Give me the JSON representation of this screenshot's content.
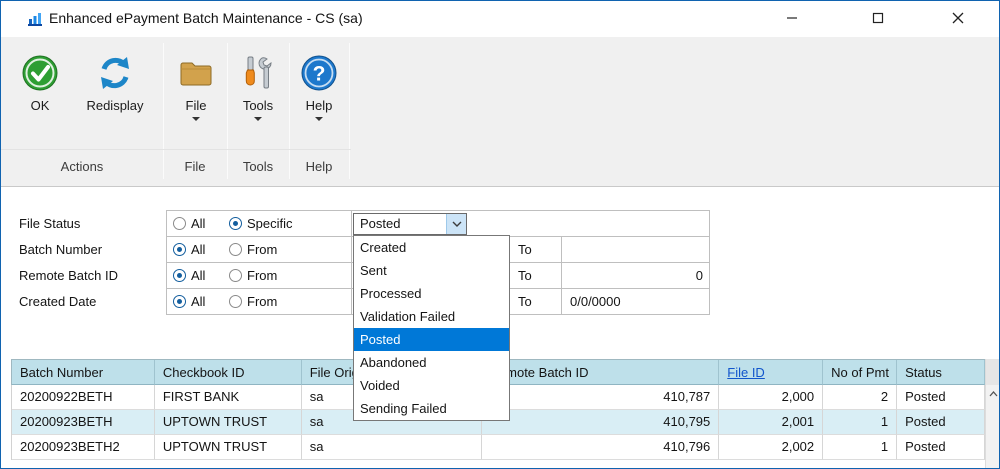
{
  "titlebar": {
    "title": "Enhanced ePayment Batch Maintenance - CS (sa)"
  },
  "ribbon": {
    "buttons": [
      {
        "label": "OK"
      },
      {
        "label": "Redisplay"
      },
      {
        "label": "File"
      },
      {
        "label": "Tools"
      },
      {
        "label": "Help"
      }
    ],
    "groups": [
      "Actions",
      "File",
      "Tools",
      "Help"
    ]
  },
  "filters": {
    "rows": [
      {
        "label": "File Status",
        "option1": "All",
        "option2": "Specific",
        "selected": "Specific",
        "value": "Posted"
      },
      {
        "label": "Batch Number",
        "option1": "All",
        "option2": "From",
        "selected": "All",
        "to_label": "To",
        "to_value": ""
      },
      {
        "label": "Remote Batch ID",
        "option1": "All",
        "option2": "From",
        "selected": "All",
        "to_label": "To",
        "to_value": "0"
      },
      {
        "label": "Created Date",
        "option1": "All",
        "option2": "From",
        "selected": "All",
        "to_label": "To",
        "to_value": "0/0/0000"
      }
    ]
  },
  "file_status_dropdown": {
    "items": [
      "Created",
      "Sent",
      "Processed",
      "Validation Failed",
      "Posted",
      "Abandoned",
      "Voided",
      "Sending Failed"
    ],
    "selected": "Posted"
  },
  "table": {
    "headers": [
      "Batch Number",
      "Checkbook ID",
      "File Origin",
      "Remote Batch ID",
      "File ID",
      "No of Pmt",
      "Status"
    ],
    "rows": [
      [
        "20200922BETH",
        "FIRST BANK",
        "sa",
        "410,787",
        "2,000",
        "2",
        "Posted"
      ],
      [
        "20200923BETH",
        "UPTOWN TRUST",
        "sa",
        "410,795",
        "2,001",
        "1",
        "Posted"
      ],
      [
        "20200923BETH2",
        "UPTOWN TRUST",
        "sa",
        "410,796",
        "2,002",
        "1",
        "Posted"
      ]
    ]
  },
  "colors": {
    "window_border": "#1063b0",
    "ribbon_bg": "#f0f0f0",
    "table_header_bg": "#bee0ea",
    "alt_row_bg": "#d9eef5",
    "selection_bg": "#0078d7",
    "link_blue": "#1155cc",
    "combo_button_bg": "#cce4f7"
  }
}
